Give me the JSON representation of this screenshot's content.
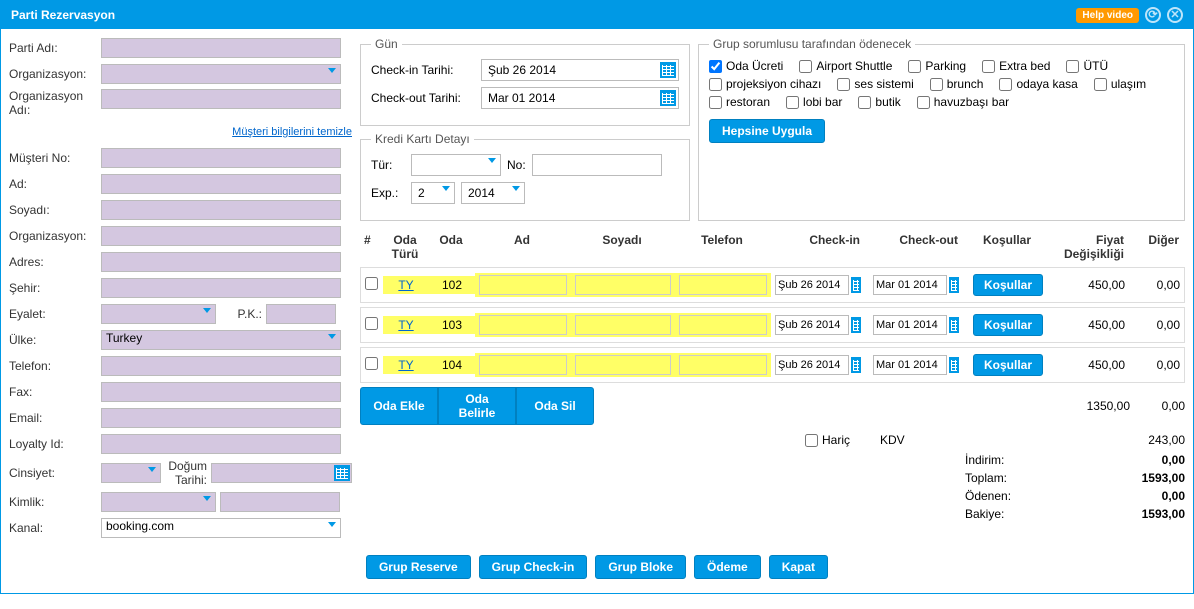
{
  "window": {
    "title": "Parti Rezervasyon",
    "help_video": "Help video"
  },
  "form": {
    "parti_adi": "Parti Adı:",
    "organizasyon": "Organizasyon:",
    "organizasyon_adi": "Organizasyon Adı:",
    "musteri_bilgilerini_temizle": "Müşteri bilgilerini temizle",
    "musteri_no": "Müşteri No:",
    "ad": "Ad:",
    "soyadi": "Soyadı:",
    "organizasyon2": "Organizasyon:",
    "adres": "Adres:",
    "sehir": "Şehir:",
    "eyalet": "Eyalet:",
    "pk": "P.K.:",
    "ulke": "Ülke:",
    "ulke_value": "Turkey",
    "telefon": "Telefon:",
    "fax": "Fax:",
    "email": "Email:",
    "loyalty": "Loyalty Id:",
    "cinsiyet": "Cinsiyet:",
    "dogum": "Doğum Tarihi:",
    "kimlik": "Kimlik:",
    "kanal": "Kanal:",
    "kanal_value": "booking.com"
  },
  "gun": {
    "legend": "Gün",
    "checkin_label": "Check-in Tarihi:",
    "checkin_value": "Şub 26 2014",
    "checkout_label": "Check-out Tarihi:",
    "checkout_value": "Mar 01 2014"
  },
  "cc": {
    "legend": "Kredi Kartı Detayı",
    "tur": "Tür:",
    "no": "No:",
    "exp": "Exp.:",
    "month": "2",
    "year": "2014"
  },
  "grup": {
    "legend": "Grup sorumlusu tarafından ödenecek",
    "options": [
      {
        "label": "Oda Ücreti",
        "checked": true
      },
      {
        "label": "Airport Shuttle",
        "checked": false
      },
      {
        "label": "Parking",
        "checked": false
      },
      {
        "label": "Extra bed",
        "checked": false
      },
      {
        "label": "ÜTÜ",
        "checked": false
      },
      {
        "label": "projeksiyon cihazı",
        "checked": false
      },
      {
        "label": "ses sistemi",
        "checked": false
      },
      {
        "label": "brunch",
        "checked": false
      },
      {
        "label": "odaya kasa",
        "checked": false
      },
      {
        "label": "ulaşım",
        "checked": false
      },
      {
        "label": "restoran",
        "checked": false
      },
      {
        "label": "lobi bar",
        "checked": false
      },
      {
        "label": "butik",
        "checked": false
      },
      {
        "label": "havuzbaşı bar",
        "checked": false
      }
    ],
    "apply_all": "Hepsine Uygula"
  },
  "table": {
    "headers": {
      "num": "#",
      "oda_turu": "Oda Türü",
      "oda": "Oda",
      "ad": "Ad",
      "soyadi": "Soyadı",
      "telefon": "Telefon",
      "checkin": "Check-in",
      "checkout": "Check-out",
      "kosullar": "Koşullar",
      "fiyat": "Fiyat Değişikliği",
      "diger": "Diğer"
    },
    "rows": [
      {
        "type": "TY",
        "room": "102",
        "checkin": "Şub 26 2014",
        "checkout": "Mar 01 2014",
        "kosul": "Koşullar",
        "fiyat": "450,00",
        "diger": "0,00"
      },
      {
        "type": "TY",
        "room": "103",
        "checkin": "Şub 26 2014",
        "checkout": "Mar 01 2014",
        "kosul": "Koşullar",
        "fiyat": "450,00",
        "diger": "0,00"
      },
      {
        "type": "TY",
        "room": "104",
        "checkin": "Şub 26 2014",
        "checkout": "Mar 01 2014",
        "kosul": "Koşullar",
        "fiyat": "450,00",
        "diger": "0,00"
      }
    ],
    "actions": {
      "ekle": "Oda Ekle",
      "belirle": "Oda Belirle",
      "sil": "Oda Sil"
    },
    "subtotal_fiyat": "1350,00",
    "subtotal_diger": "0,00",
    "haric": "Hariç",
    "kdv": "KDV",
    "kdv_value": "243,00"
  },
  "summary": {
    "indirim_label": "İndirim:",
    "indirim": "0,00",
    "toplam_label": "Toplam:",
    "toplam": "1593,00",
    "odenen_label": "Ödenen:",
    "odenen": "0,00",
    "bakiye_label": "Bakiye:",
    "bakiye": "1593,00"
  },
  "footer": {
    "reserve": "Grup Reserve",
    "checkin": "Grup Check-in",
    "bloke": "Grup Bloke",
    "odeme": "Ödeme",
    "kapat": "Kapat"
  }
}
